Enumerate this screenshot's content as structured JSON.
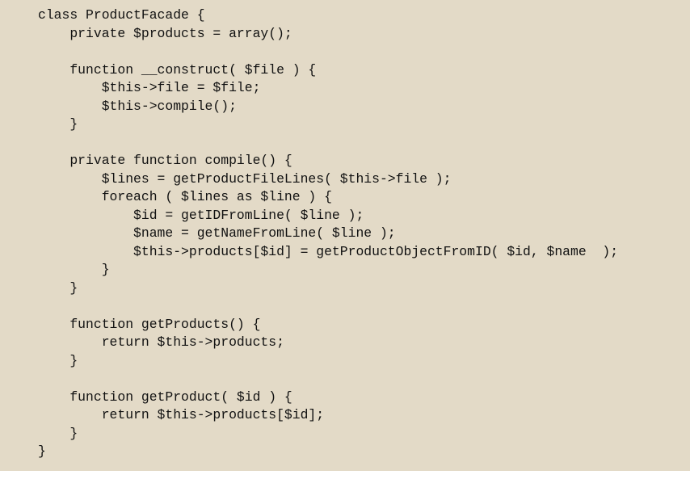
{
  "code": {
    "lines": [
      "class ProductFacade {",
      "    private $products = array();",
      "",
      "    function __construct( $file ) {",
      "        $this->file = $file;",
      "        $this->compile();",
      "    }",
      "",
      "    private function compile() {",
      "        $lines = getProductFileLines( $this->file );",
      "        foreach ( $lines as $line ) {",
      "            $id = getIDFromLine( $line );",
      "            $name = getNameFromLine( $line );",
      "            $this->products[$id] = getProductObjectFromID( $id, $name  );",
      "        }",
      "    }",
      "",
      "    function getProducts() {",
      "        return $this->products;",
      "    }",
      "",
      "    function getProduct( $id ) {",
      "        return $this->products[$id];",
      "    }",
      "}"
    ]
  },
  "colors": {
    "code_background": "#e3dac7",
    "page_background": "#ffffff",
    "text": "#111111"
  }
}
